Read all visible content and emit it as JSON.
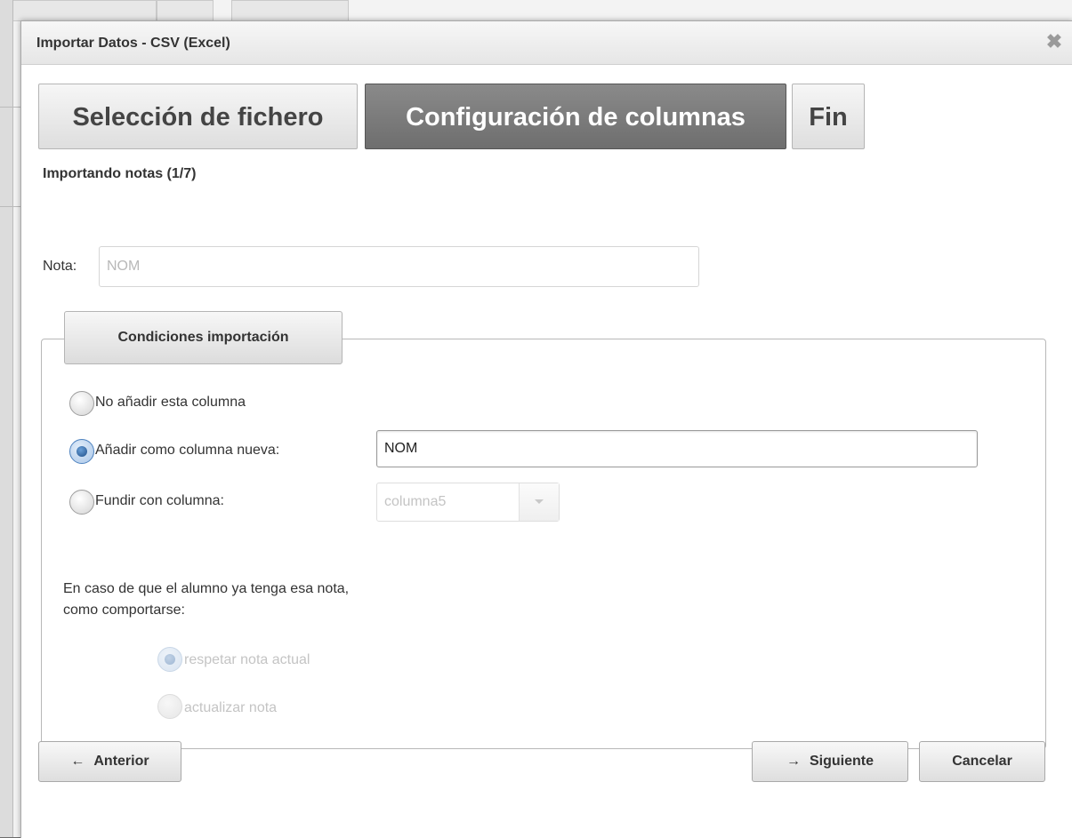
{
  "dialog": {
    "title": "Importar Datos - CSV (Excel)",
    "close_glyph": "✖"
  },
  "steps": [
    {
      "label": "Selección de fichero",
      "state": "inactive"
    },
    {
      "label": "Configuración de columnas",
      "state": "active"
    },
    {
      "label": "Fin",
      "state": "inactive"
    }
  ],
  "subtitle": "Importando notas (1/7)",
  "nota": {
    "label": "Nota:",
    "value": "NOM"
  },
  "conditions": {
    "legend": "Condiciones importación",
    "options": [
      {
        "label": "No añadir esta columna",
        "checked": false
      },
      {
        "label": "Añadir como columna nueva:",
        "checked": true
      },
      {
        "label": "Fundir con columna:",
        "checked": false
      }
    ],
    "new_column_value": "NOM",
    "merge_column": {
      "selected": "columna5",
      "disabled": true
    },
    "info_line1": "En caso de que el alumno ya tenga esa nota,",
    "info_line2": "como comportarse:",
    "behavior_options": [
      {
        "label": "respetar nota actual",
        "checked": true,
        "disabled": true
      },
      {
        "label": "actualizar nota",
        "checked": false,
        "disabled": true
      }
    ]
  },
  "buttons": {
    "previous": {
      "arrow": "←",
      "label": "Anterior"
    },
    "next": {
      "arrow": "→",
      "label": "Siguiente"
    },
    "cancel": {
      "label": "Cancelar"
    }
  },
  "colors": {
    "active_step": "#7a7a7a",
    "radio_selected": "#2a5fa3"
  }
}
